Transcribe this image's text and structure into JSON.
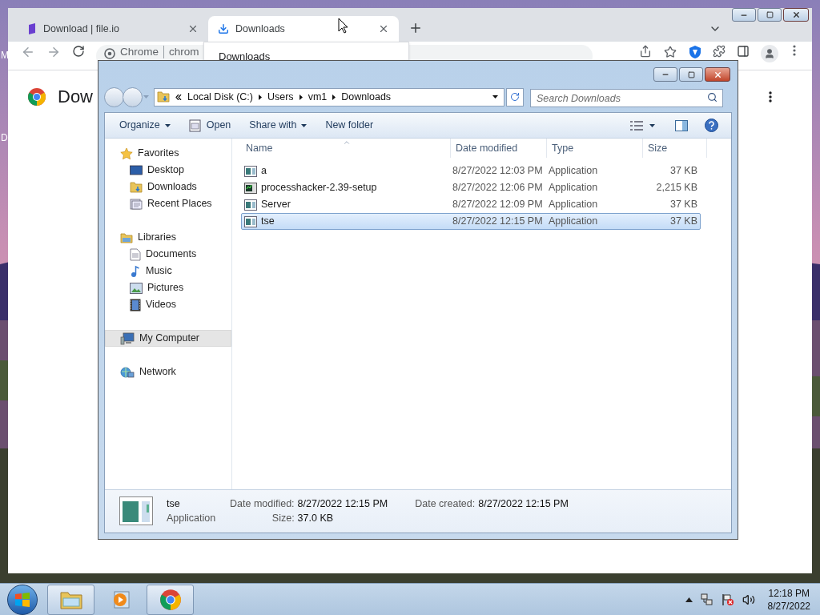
{
  "desktop": {
    "kind": "picture",
    "edge_labels": [
      "M",
      "D"
    ]
  },
  "browser": {
    "tabs": [
      {
        "title": "Download | file.io",
        "selected": false
      },
      {
        "title": "Downloads",
        "selected": true
      }
    ],
    "tab_menu": {
      "item": "Downloads"
    },
    "omnibox": {
      "chip": "Chrome",
      "text": "chrom"
    },
    "page": {
      "heading": "Dow"
    }
  },
  "explorer": {
    "breadcrumb": [
      "Local Disk (C:)",
      "Users",
      "vm1",
      "Downloads"
    ],
    "search": {
      "placeholder": "Search Downloads"
    },
    "toolbar": [
      {
        "label": "Organize",
        "kind": "menu"
      },
      {
        "label": "Open",
        "kind": "icon"
      },
      {
        "label": "Share with",
        "kind": "menu"
      },
      {
        "label": "New folder",
        "kind": "plain"
      }
    ],
    "nav": [
      {
        "label": "Favorites",
        "selected": false,
        "children": [
          {
            "label": "Desktop",
            "selected": false
          },
          {
            "label": "Downloads",
            "selected": false
          },
          {
            "label": "Recent Places",
            "selected": false
          }
        ]
      },
      {
        "label": "Libraries",
        "selected": false,
        "children": [
          {
            "label": "Documents",
            "selected": false
          },
          {
            "label": "Music",
            "selected": false
          },
          {
            "label": "Pictures",
            "selected": false
          },
          {
            "label": "Videos",
            "selected": false
          }
        ]
      },
      {
        "label": "My Computer",
        "selected": true
      },
      {
        "label": "Network",
        "selected": false
      }
    ],
    "columns": [
      "Name",
      "Date modified",
      "Type",
      "Size"
    ],
    "files": [
      {
        "name": "a",
        "date": "8/27/2022 12:03 PM",
        "type": "Application",
        "size": "37 KB",
        "kind": "app",
        "selected": false
      },
      {
        "name": "processhacker-2.39-setup",
        "date": "8/27/2022 12:06 PM",
        "type": "Application",
        "size": "2,215 KB",
        "kind": "setup",
        "selected": false
      },
      {
        "name": "Server",
        "date": "8/27/2022 12:09 PM",
        "type": "Application",
        "size": "37 KB",
        "kind": "app",
        "selected": false
      },
      {
        "name": "tse",
        "date": "8/27/2022 12:15 PM",
        "type": "Application",
        "size": "37 KB",
        "kind": "app",
        "selected": true
      }
    ],
    "details": {
      "name": "tse",
      "type": "Application",
      "fields": [
        {
          "label": "Date modified:",
          "value": "8/27/2022 12:15 PM"
        },
        {
          "label": "Date created:",
          "value": "8/27/2022 12:15 PM"
        },
        {
          "label": "Size:",
          "value": "37.0 KB"
        }
      ]
    }
  },
  "taskbar": {
    "items": [
      {
        "kind": "explorer",
        "running": true
      },
      {
        "kind": "media",
        "running": false
      },
      {
        "kind": "chrome",
        "running": true
      }
    ],
    "clock": {
      "time": "12:18 PM",
      "date": "8/27/2022"
    }
  }
}
